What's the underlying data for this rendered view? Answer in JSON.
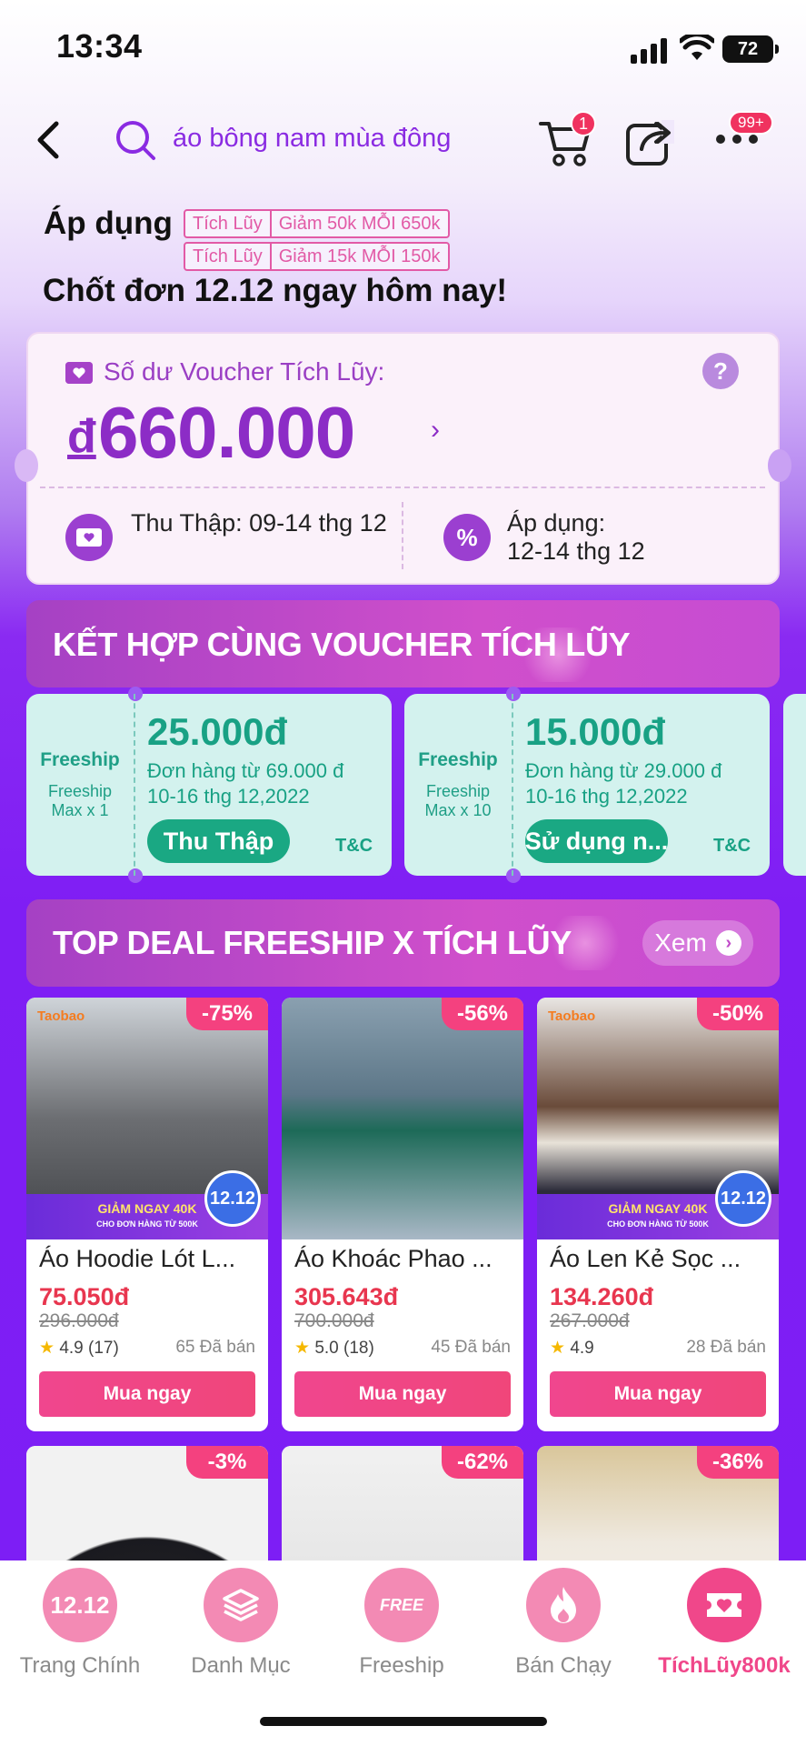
{
  "status_bar": {
    "time": "13:34",
    "battery": "72"
  },
  "top_nav": {
    "search_query": "áo bông nam mùa đông",
    "cart_badge": "1",
    "more_badge": "99+"
  },
  "apply": {
    "label": "Áp dụng",
    "tags": [
      {
        "type": "Tích Lũy",
        "text": "Giảm 50k MỖI 650k"
      },
      {
        "type": "Tích Lũy",
        "text": "Giảm 15k MỖI 150k"
      }
    ],
    "headline": "Chốt đơn 12.12 ngay hôm nay!"
  },
  "voucher_balance": {
    "label": "Số dư Voucher Tích Lũy:",
    "help": "?",
    "currency": "đ",
    "amount": "660.000",
    "collect": "Thu Thập: 09-14 thg 12",
    "apply_label": "Áp dụng:",
    "apply_date": "12-14 thg 12"
  },
  "combine_banner": {
    "title": "KẾT HỢP CÙNG VOUCHER TÍCH LŨY"
  },
  "freeship_vouchers": [
    {
      "type": "Freeship",
      "sub1": "Freeship",
      "sub2": "Max x 1",
      "amount": "25.000đ",
      "min": "Đơn hàng từ 69.000 đ",
      "date": "10-16 thg 12,2022",
      "button": "Thu Thập",
      "tc": "T&C"
    },
    {
      "type": "Freeship",
      "sub1": "Freeship",
      "sub2": "Max x 10",
      "amount": "15.000đ",
      "min": "Đơn hàng từ 29.000 đ",
      "date": "10-16 thg 12,2022",
      "button": "Sử dụng n...",
      "tc": "T&C"
    }
  ],
  "top_deal": {
    "title": "TOP DEAL FREESHIP X TÍCH LŨY",
    "more": "Xem"
  },
  "products": [
    {
      "discount": "-75%",
      "brand": "Taobao",
      "promo": "GIẢM NGAY 40K",
      "promo_sub": "CHO ĐƠN HÀNG TỪ 500K",
      "badge": "12.12",
      "name": "Áo Hoodie Lót L...",
      "price": "75.050đ",
      "original": "296.000đ",
      "rating": "4.9",
      "reviews": "(17)",
      "sold": "65 Đã bán",
      "button": "Mua ngay"
    },
    {
      "discount": "-56%",
      "name": "Áo Khoác Phao ...",
      "price": "305.643đ",
      "original": "700.000đ",
      "rating": "5.0",
      "reviews": "(18)",
      "sold": "45 Đã bán",
      "button": "Mua ngay"
    },
    {
      "discount": "-50%",
      "brand": "Taobao",
      "promo": "GIẢM NGAY 40K",
      "promo_sub": "CHO ĐƠN HÀNG TỪ 500K",
      "badge": "12.12",
      "name": "Áo Len Kẻ Sọc ...",
      "price": "134.260đ",
      "original": "267.000đ",
      "rating": "4.9",
      "reviews": "",
      "sold": "28 Đã bán",
      "button": "Mua ngay"
    }
  ],
  "products_row2": [
    {
      "discount": "-3%"
    },
    {
      "discount": "-62%"
    },
    {
      "discount": "-36%"
    }
  ],
  "bottom_nav": [
    {
      "icon": "12.12",
      "label": "Trang Chính"
    },
    {
      "icon": "layers",
      "label": "Danh Mục"
    },
    {
      "icon": "FREE",
      "label": "Freeship"
    },
    {
      "icon": "flame",
      "label": "Bán Chạy"
    },
    {
      "icon": "ticket",
      "label": "TíchLũy800k"
    }
  ]
}
